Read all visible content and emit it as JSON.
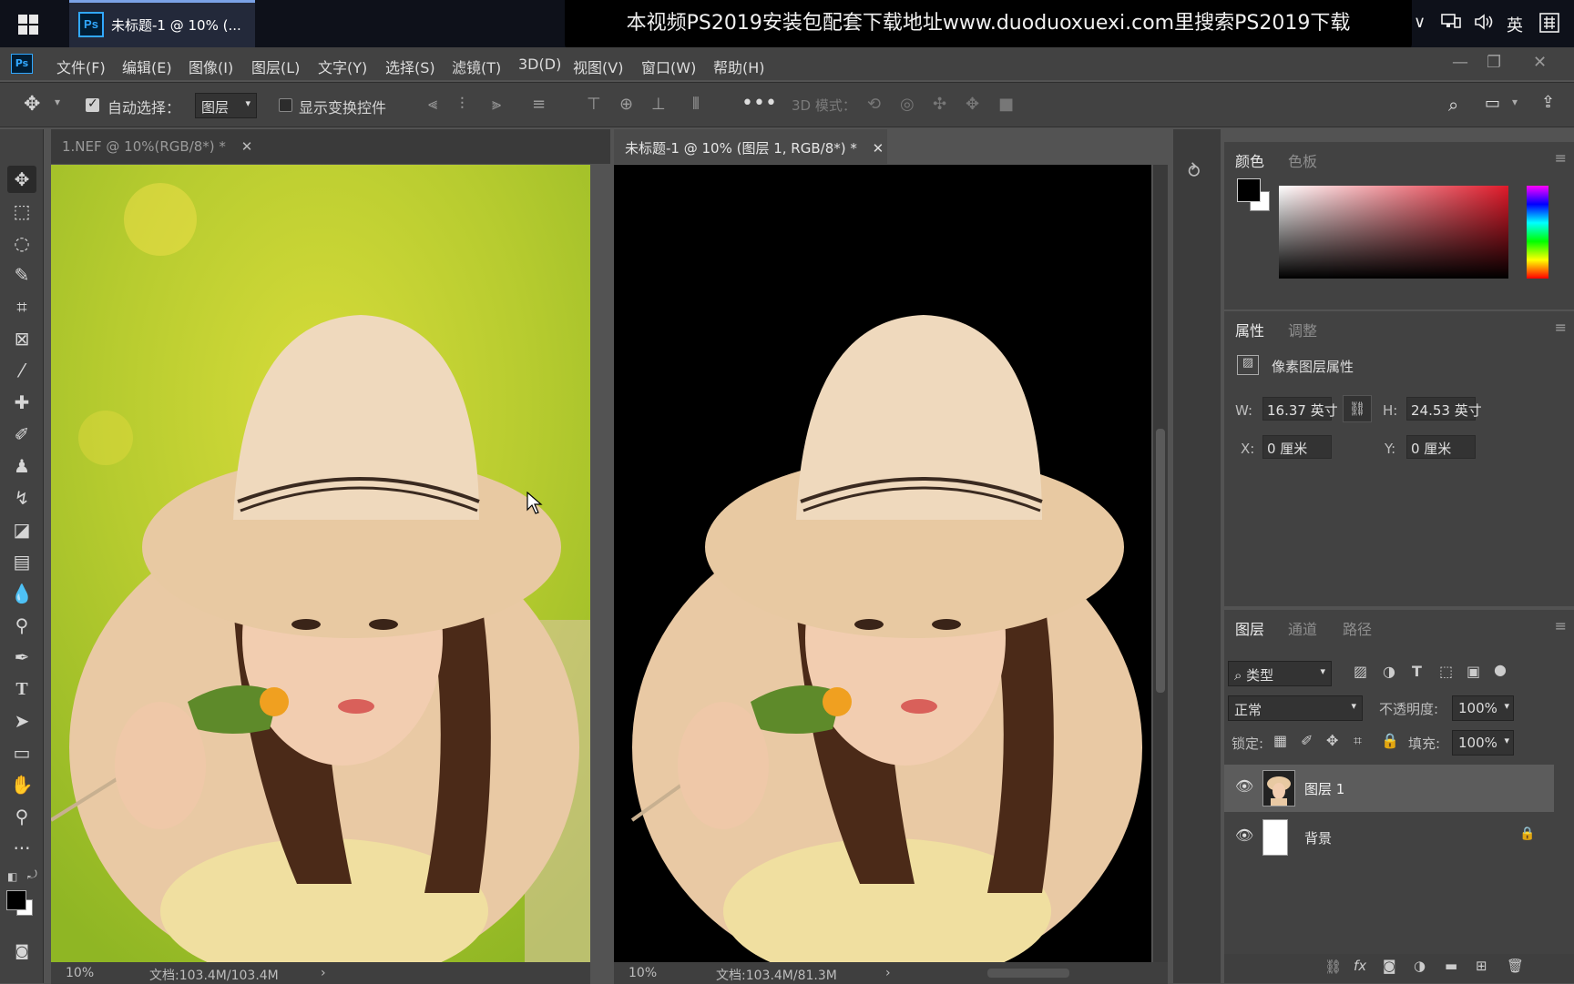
{
  "taskbar": {
    "task_title": "未标题-1 @ 10% (...",
    "banner": "本视频PS2019安装包配套下载地址www.duoduoxuexi.com里搜索PS2019下载",
    "tray": {
      "chevron": "∨",
      "ime": "英"
    }
  },
  "app": {
    "logo": "Ps"
  },
  "menu": [
    "文件(F)",
    "编辑(E)",
    "图像(I)",
    "图层(L)",
    "文字(Y)",
    "选择(S)",
    "滤镜(T)",
    "3D(D)",
    "视图(V)",
    "窗口(W)",
    "帮助(H)"
  ],
  "options": {
    "auto_select_label": "自动选择：",
    "auto_select_checked": true,
    "auto_select_target": "图层",
    "show_transform_label": "显示变换控件",
    "show_transform_checked": false,
    "mode_3d_label": "3D 模式："
  },
  "documents": [
    {
      "tab": "1.NEF @ 10%(RGB/8*) *",
      "zoom": "10%",
      "doc_size": "文档:103.4M/103.4M",
      "active": false
    },
    {
      "tab": "未标题-1 @ 10% (图层 1, RGB/8*) *",
      "zoom": "10%",
      "doc_size": "文档:103.4M/81.3M",
      "active": true
    }
  ],
  "color_panel": {
    "tabs": [
      "颜色",
      "色板"
    ],
    "foreground": "#000000",
    "background": "#ffffff",
    "hue": "#e03040"
  },
  "properties_panel": {
    "tabs": [
      "属性",
      "调整"
    ],
    "header": "像素图层属性",
    "w_label": "W:",
    "w_value": "16.37 英寸",
    "h_label": "H:",
    "h_value": "24.53 英寸",
    "x_label": "X:",
    "x_value": "0 厘米",
    "y_label": "Y:",
    "y_value": "0 厘米"
  },
  "layers_panel": {
    "tabs": [
      "图层",
      "通道",
      "路径"
    ],
    "filter": "类型",
    "blend_mode": "正常",
    "opacity_label": "不透明度:",
    "opacity": "100%",
    "lock_label": "锁定:",
    "fill_label": "填充:",
    "fill": "100%",
    "layers": [
      {
        "name": "图层 1",
        "selected": true,
        "locked": false
      },
      {
        "name": "背景",
        "selected": false,
        "locked": true
      }
    ]
  }
}
